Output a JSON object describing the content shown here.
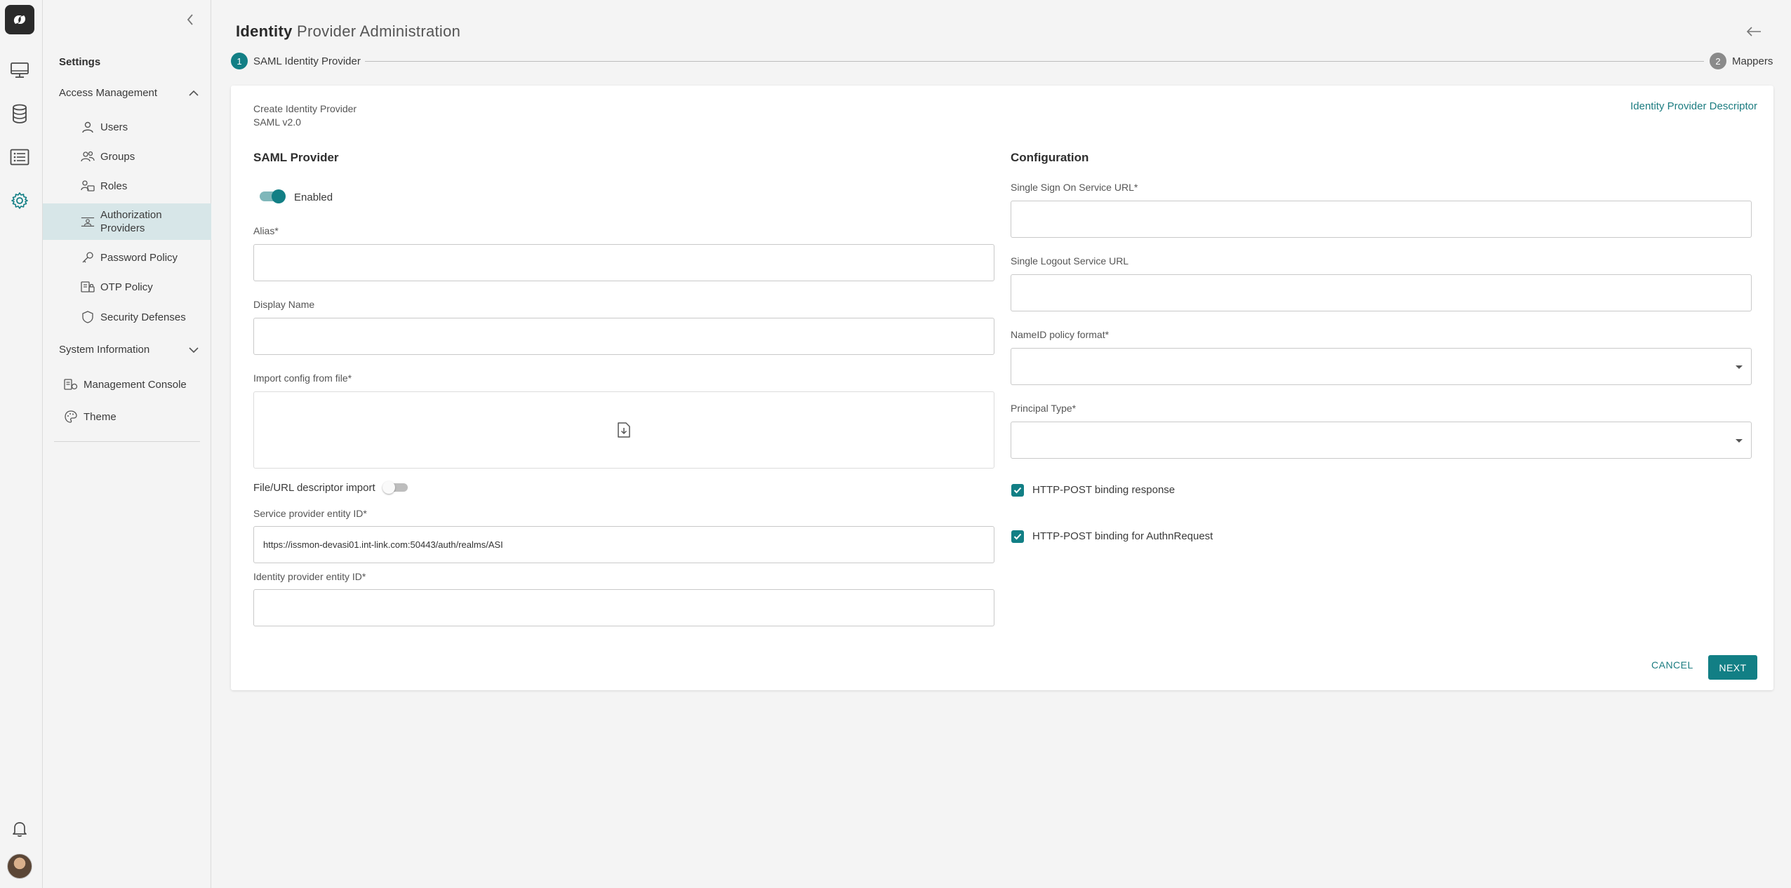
{
  "header": {
    "title_strong": "Identity",
    "title_rest": " Provider Administration"
  },
  "stepper": {
    "steps": [
      {
        "number": "1",
        "label": "SAML Identity Provider"
      },
      {
        "number": "2",
        "label": "Mappers"
      }
    ]
  },
  "sidebar": {
    "heading": "Settings",
    "sections": [
      {
        "label": "Access Management",
        "items": [
          {
            "label": "Users",
            "icon": "user-icon"
          },
          {
            "label": "Groups",
            "icon": "group-icon"
          },
          {
            "label": "Roles",
            "icon": "roles-icon"
          },
          {
            "label": "Authorization",
            "label2": "Providers",
            "icon": "authorization-icon"
          },
          {
            "label": "Password Policy",
            "icon": "key-icon"
          },
          {
            "label": "OTP Policy",
            "icon": "otp-icon"
          },
          {
            "label": "Security Defenses",
            "icon": "shield-icon"
          }
        ]
      },
      {
        "label": "System Information",
        "items": [
          {
            "label": "Management Console",
            "icon": "console-icon"
          },
          {
            "label": "Theme",
            "icon": "palette-icon"
          }
        ]
      }
    ]
  },
  "card": {
    "caption_line1": "Create Identity Provider",
    "caption_line2": "SAML v2.0",
    "descriptor_link": "Identity Provider Descriptor",
    "left": {
      "title": "SAML Provider",
      "enabled_label": "Enabled",
      "alias_label": "Alias*",
      "alias_value": "",
      "display_name_label": "Display Name",
      "display_name_value": "",
      "import_label": "Import config from file*",
      "descriptor_import_label": "File/URL descriptor import",
      "sp_entity_label": "Service provider entity ID*",
      "sp_entity_value": "https://issmon-devasi01.int-link.com:50443/auth/realms/ASI",
      "idp_entity_label": "Identity provider entity ID*",
      "idp_entity_value": ""
    },
    "right": {
      "title": "Configuration",
      "sso_label": "Single Sign On Service URL*",
      "sso_value": "",
      "slo_label": "Single Logout Service URL",
      "slo_value": "",
      "nameid_label": "NameID policy format*",
      "nameid_value": "",
      "principal_label": "Principal Type*",
      "principal_value": "",
      "post_response_label": "HTTP-POST binding response",
      "post_authn_label": "HTTP-POST binding for AuthnRequest"
    },
    "cancel_label": "CANCEL",
    "next_label": "NEXT"
  },
  "colors": {
    "accent": "#127f85",
    "active_bg": "#d7e6e8"
  }
}
